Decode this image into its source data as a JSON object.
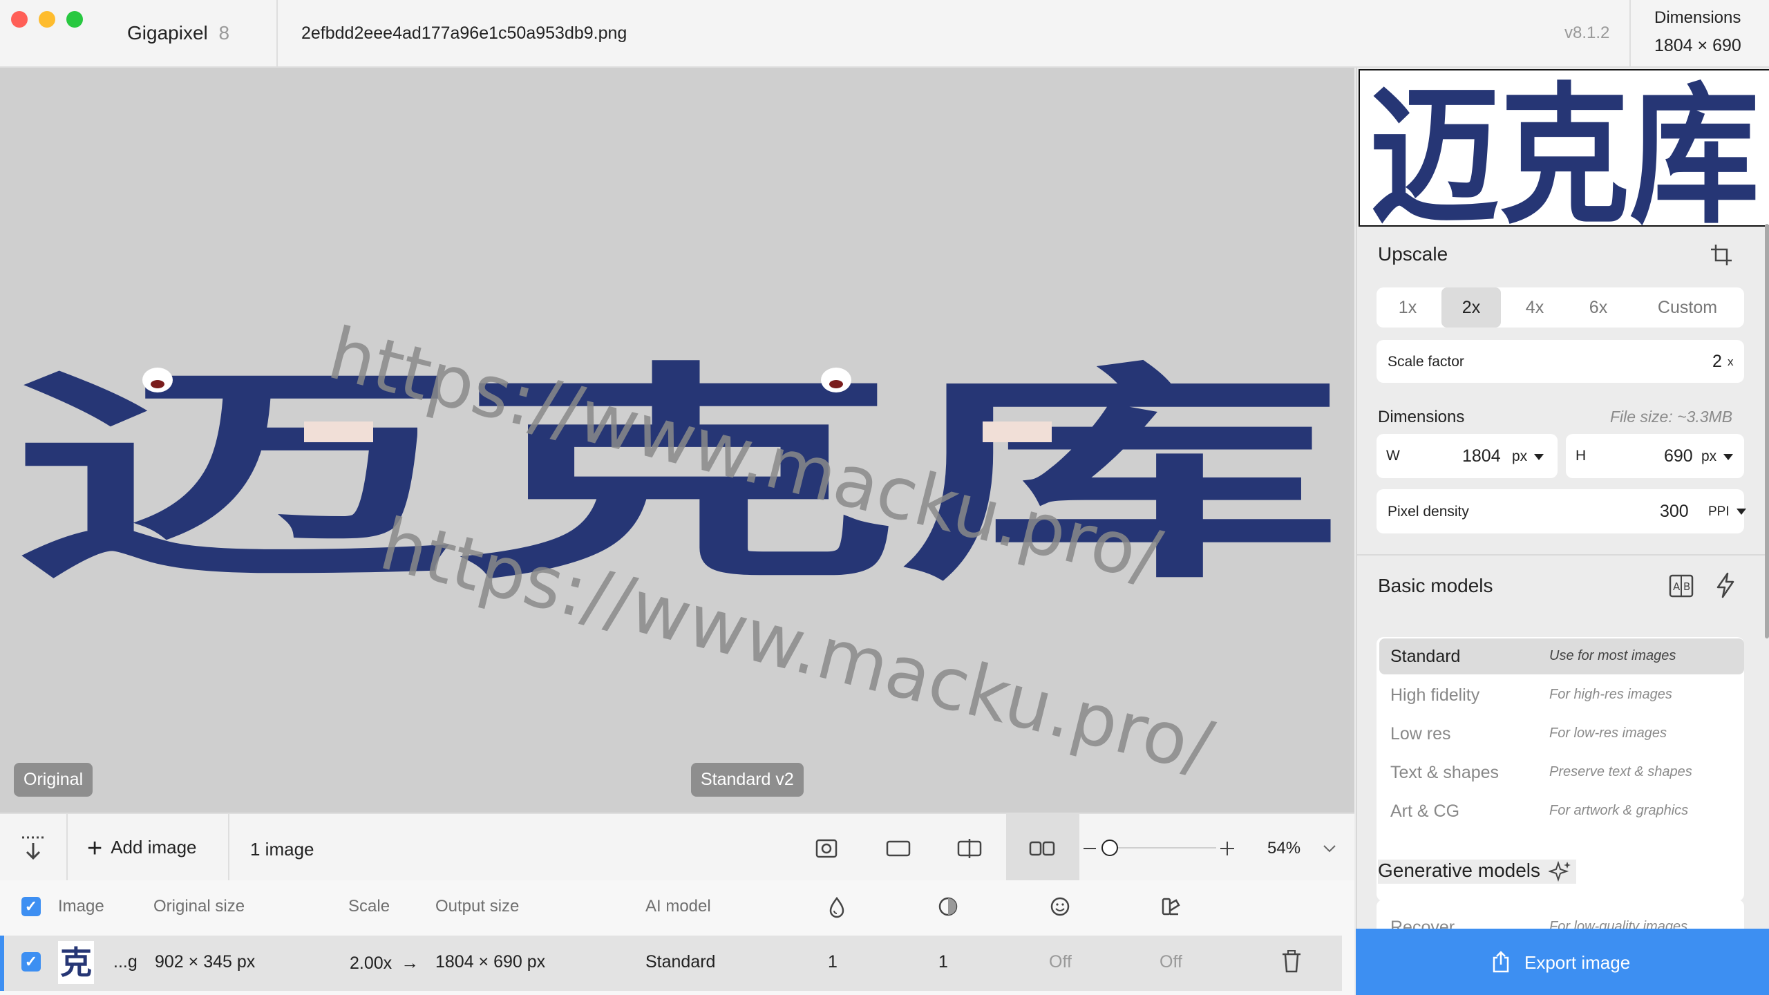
{
  "window": {
    "app_name": "Gigapixel",
    "app_version_major": "8",
    "filename": "2efbdd2eee4ad177a96e1c50a953db9.png",
    "version": "v8.1.2",
    "dimensions_label": "Dimensions",
    "dimensions_value": "1804 × 690"
  },
  "canvas": {
    "watermark": "https://www.macku.pro/",
    "logo_text": "迈克库",
    "badge_left": "Original",
    "badge_center": "Standard v2"
  },
  "toolbar": {
    "add_image_label": "Add image",
    "image_count": "1 image",
    "zoom_value": 0.0,
    "zoom_label": "54%"
  },
  "table": {
    "headers": [
      "Image",
      "Original size",
      "Scale",
      "Output size",
      "AI model"
    ],
    "row": {
      "thumb_char": "克",
      "name": "...g",
      "original_size": "902 × 345 px",
      "scale": "2.00x",
      "arrow": "→",
      "output_size": "1804 × 690 px",
      "model": "Standard",
      "val1": "1",
      "val2": "1",
      "val3": "Off",
      "val4": "Off"
    }
  },
  "panel": {
    "upscale_title": "Upscale",
    "scale_options": [
      "1x",
      "2x",
      "4x",
      "6x",
      "Custom"
    ],
    "selected_scale": "2x",
    "scale_factor_label": "Scale factor",
    "scale_factor_value": "2",
    "scale_factor_unit": "x",
    "dimensions_title": "Dimensions",
    "file_size": "File size: ~3.3MB",
    "w_label": "W",
    "w_value": "1804",
    "w_unit": "px",
    "h_label": "H",
    "h_value": "690",
    "h_unit": "px",
    "pixel_density_label": "Pixel density",
    "pixel_density_value": "300",
    "pixel_density_unit": "PPI",
    "basic_models_title": "Basic models",
    "basic_models": [
      {
        "name": "Standard",
        "desc": "Use for most images"
      },
      {
        "name": "High fidelity",
        "desc": "For high-res images"
      },
      {
        "name": "Low res",
        "desc": "For low-res images"
      },
      {
        "name": "Text & shapes",
        "desc": "Preserve text & shapes"
      },
      {
        "name": "Art & CG",
        "desc": "For artwork & graphics"
      }
    ],
    "generative_title": "Generative models",
    "generative_models": [
      {
        "name": "Recover",
        "desc": "For low-quality images"
      }
    ],
    "export_label": "Export image"
  },
  "colors": {
    "accent": "#3d8ff2",
    "logo_navy": "#263675",
    "canvas_bg": "#cfcfcf"
  }
}
